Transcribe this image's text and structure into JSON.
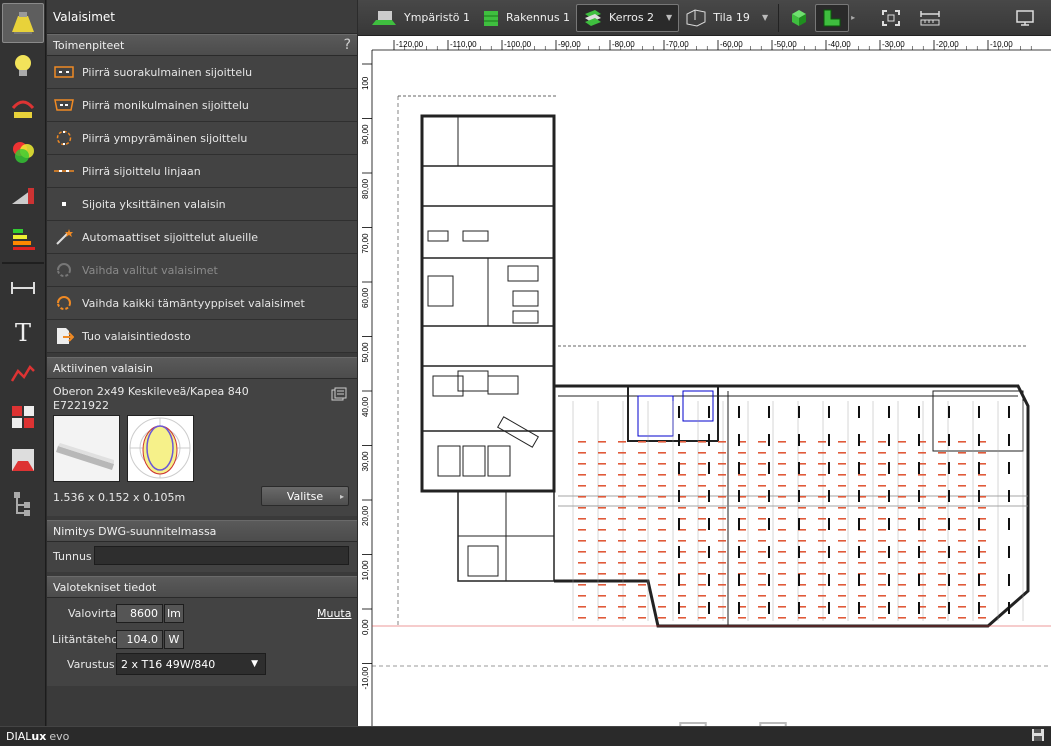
{
  "panel": {
    "title": "Valaisimet",
    "actions": {
      "title": "Toimenpiteet",
      "help": "?",
      "items": [
        {
          "label": "Piirrä suorakulmainen sijoittelu"
        },
        {
          "label": "Piirrä monikulmainen sijoittelu"
        },
        {
          "label": "Piirrä ympyrämäinen sijoittelu"
        },
        {
          "label": "Piirrä sijoittelu linjaan"
        },
        {
          "label": "Sijoita yksittäinen valaisin"
        },
        {
          "label": "Automaattiset sijoittelut alueille"
        },
        {
          "label": "Vaihda valitut valaisimet"
        },
        {
          "label": "Vaihda kaikki tämäntyyppiset valaisimet"
        },
        {
          "label": "Tuo valaisintiedosto"
        }
      ]
    },
    "active_luminaire": {
      "title": "Aktiivinen valaisin",
      "name": "Oberon 2x49 Keskileveä/Kapea 840",
      "code": "E7221922",
      "dimensions": "1.536 x 0.152 x 0.105m",
      "select_label": "Valitse"
    },
    "dwg": {
      "title": "Nimitys DWG-suunnitelmassa",
      "id_label": "Tunnus",
      "id_value": ""
    },
    "photometric": {
      "title": "Valotekniset tiedot",
      "flux_label": "Valovirta",
      "flux_value": "8600",
      "flux_unit": "lm",
      "change_link": "Muuta",
      "power_label": "Liitäntäteho",
      "power_value": "104.0",
      "power_unit": "W",
      "equipment_label": "Varustus",
      "equipment_value": "2 x T16 49W/840"
    }
  },
  "toolbar": {
    "environment": "Ympäristö 1",
    "building": "Rakennus 1",
    "floor": "Kerros 2",
    "room": "Tila 19"
  },
  "ruler": {
    "x_ticks": [
      "-120,00",
      "-110,00",
      "-100,00",
      "-90,00",
      "-80,00",
      "-70,00",
      "-60,00",
      "-50,00",
      "-40,00",
      "-30,00",
      "-20,00",
      "-10,00"
    ],
    "y_ticks": [
      "100",
      "90,00",
      "80,00",
      "70,00",
      "60,00",
      "50,00",
      "40,00",
      "30,00",
      "20,00",
      "10,00",
      "0,00",
      "-10,00"
    ]
  },
  "status": {
    "brand_a": "DIAL",
    "brand_b": "ux",
    "brand_c": "evo"
  },
  "colors": {
    "accent_yellow": "#e8d23a",
    "accent_green": "#3fbf3f",
    "accent_orange": "#f08a24"
  }
}
